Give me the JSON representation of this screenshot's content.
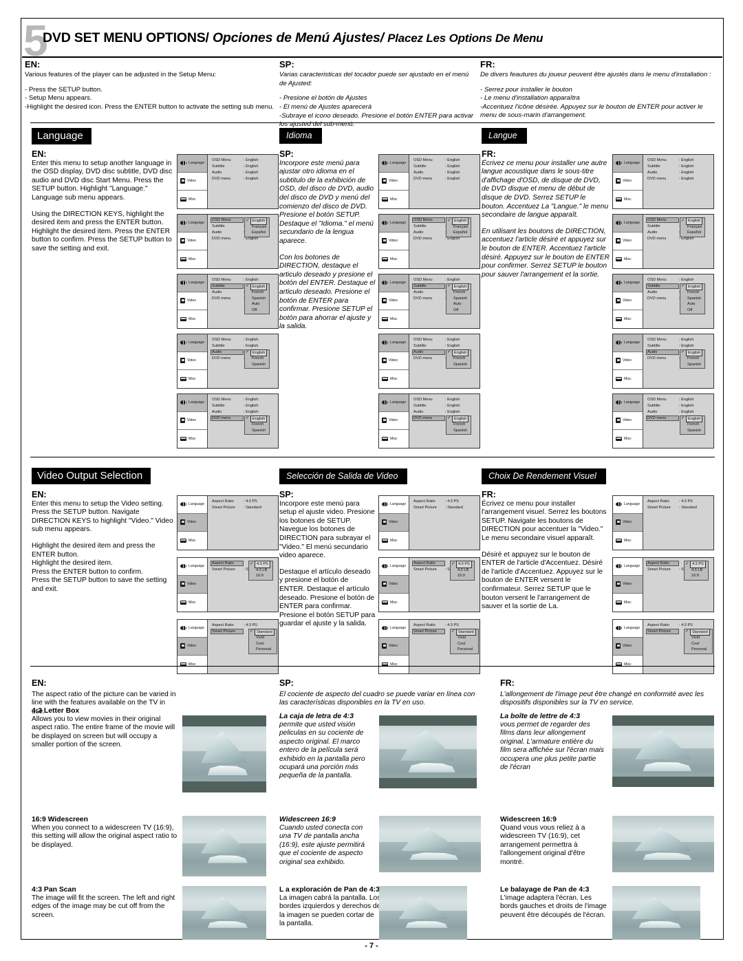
{
  "chapter": {
    "number": "5",
    "title_en": "DVD SET MENU OPTIONS/",
    "title_sp": "Opciones de Menú Ajustes/",
    "title_fr": "Placez Les Options De Menu"
  },
  "header": {
    "en": {
      "tag": "EN:",
      "lead": "Various features of the player can be adjusted in the Setup Menu:",
      "bullets": [
        "- Press the SETUP button.",
        "- Setup Menu appears.",
        "-Highlight the desired icon. Press the ENTER button to activate the setting sub menu."
      ]
    },
    "sp": {
      "tag": "SP:",
      "lead": "Varias caracteristicas del tocador puede ser ajustado en el menú de Ajusted:",
      "bullets": [
        "- Presione el botón de Ajustes",
        "- El menú de Ajustes aparecerá",
        "-Subraye el icono deseado. Presione el botón ENTER para activar los ajusted del sub-menú."
      ]
    },
    "fr": {
      "tag": "FR:",
      "lead": "De divers feautures du joueur peuvent être ajustés dans le menu d'installation :",
      "bullets": [
        "- Serrez pour installer le bouton",
        "- Le menu d'installation apparaîtra",
        "-Accentuez l'icône désirée. Appuyez sur le bouton de ENTER pour activer le menu de sous-marin d'arrangement."
      ]
    }
  },
  "language_section": {
    "banner_en": "Language",
    "banner_sp": "Idioma",
    "banner_fr": "Langue",
    "en": {
      "tag": "EN:",
      "p1": "Enter this menu to setup another language in the OSD display, DVD disc subtitle, DVD disc audio and DVD disc Start Menu. Press the SETUP button. Highlight \"Language.\" Language sub menu appears.",
      "p2": "Using the DIRECTION KEYS, highlight the desired item and press the ENTER button.  Highlight the desired item. Press the ENTER button to confirm. Press the SETUP button to save the setting and exit."
    },
    "sp": {
      "tag": "SP:",
      "p1": "Incorpore este menú para ajustar otro idioma en el subtitulo de la exhibición de OSD, del disco de DVD, audio del disco de DVD y menú del comienzo del disco de DVD. Presione el botón SETUP. Destaque el \"Idioma.\" el menú secundario de la lengua aparece.",
      "p2": "Con los botones de DIRECTION, destaque el articulo deseado y presione el botón del ENTER. Destaque el articulo deseado. Presione el botón de ENTER para confirmar. Presione SETUP el botón para ahorrar el ajuste y la salida."
    },
    "fr": {
      "tag": "FR:",
      "p1": "Écrivez ce menu pour installer une autre langue acoustique dans le sous-titre d'affichage d'OSD, de disque de DVD, de DVD disque et menu de début de disque de DVD. Serrez SETUP le bouton. Accentuez La \"Langue.\" le menu secondaire de langue apparaît.",
      "p2": "En utilisant les boutons de DIRECTION, accentuez l'article désiré et appuyez sur le bouton de ENTER. Accentuez l'article désiré. Appuyez sur le bouton de ENTER pour confirmer. Serrez SETUP le bouton pour sauver l'arrangement et la sortie."
    }
  },
  "video_section": {
    "banner_en": "Video Output Selection",
    "banner_sp": "Selección de Salida de Video",
    "banner_fr": "Choix De Rendement Visuel",
    "en": {
      "tag": "EN:",
      "p1": "Enter this menu to setup the Video setting. Press the SETUP button. Navigate DIRECTION KEYS to highlight \"Video.\" Video sub menu appears.",
      "p2": "Highlight the desired item and press the ENTER button.\nHighlight the desired item.\nPress the ENTER button to confirm.\nPress the SETUP button to save the setting and exit."
    },
    "sp": {
      "tag": "SP:",
      "p1": "Incorpore este menú para setup el ajuste video. Presione los botones de SETUP. Navegue los botones de DIRECTION para subrayar el \"Video.\" El menú secundario video aparece.",
      "p2": "Destaque el artículo deseado y presione el botón de ENTER. Destaque el artículo deseado. Presione el botón de ENTER para confirmar. Presione el botón SETUP para guardar el ajuste y la salida."
    },
    "fr": {
      "tag": "FR:",
      "p1": "Écrivez ce menu pour installer l'arrangement visuel. Serrez les boutons SETUP. Navigate les boutons de DIRECTION pour accentuer la \"Video.\" Le menu secondaire visuel apparaît.",
      "p2": "Désiré et appuyez sur le bouton de ENTER de l'article d'Accentuez. Désiré de l'article d'Accentuez. Appuyez sur le bouton de ENTER versent le confirmateur. Serrez SETUP que le bouton versent le l'arrangement de sauver et la sortie de La."
    }
  },
  "osd": {
    "sidebar": [
      {
        "label": "Language",
        "icon": "globe-icon"
      },
      {
        "label": "Video",
        "icon": "tv-icon"
      },
      {
        "label": "Misc",
        "icon": "misc-icon"
      }
    ],
    "language_rows": [
      {
        "name": "OSD Menu",
        "value": ": English"
      },
      {
        "name": "Subtitle",
        "value": ": English"
      },
      {
        "name": "Audio",
        "value": ": English"
      },
      {
        "name": "DVD menu",
        "value": ": English"
      }
    ],
    "video_rows": [
      {
        "name": "Aspect Ratio",
        "value": ": 4:3 PS"
      },
      {
        "name": "Smart Picture",
        "value": ": Standard"
      }
    ],
    "dropdowns": {
      "osd_menu": [
        "English",
        "Français",
        "Español"
      ],
      "subtitle": [
        "English",
        "French",
        "Spanish",
        "Auto",
        "Off"
      ],
      "audio": [
        "English",
        "French",
        "Spanish"
      ],
      "dvd_menu": [
        "English",
        "French",
        "Spanish"
      ],
      "aspect_ratio": [
        "4:3 PS",
        "4:3 LB",
        "16:9"
      ],
      "smart_picture": [
        "Standard",
        "Vivid",
        "Cool",
        "Personal"
      ]
    },
    "check_glyph": "✓"
  },
  "aspect": {
    "en": {
      "tag": "EN:",
      "intro": "The aspect ratio of the picture can be varied in line with the features available on the TV in use.",
      "items": [
        {
          "head": "4:3 Letter Box",
          "body": "Allows you to view movies in their original aspect ratio. The entire frame of the movie will be displayed on screen but will occupy a smaller portion of the screen."
        },
        {
          "head": "16:9 Widescreen",
          "body": "When you connect to a widescreen TV (16:9), this setting will allow the original aspect ratio to be displayed."
        },
        {
          "head": "4:3 Pan Scan",
          "body": "The image will fit the screen. The left and right edges of the image may be cut off from the screen."
        }
      ]
    },
    "sp": {
      "tag": "SP:",
      "intro": "El cociente de aspecto del cuadro se puede variar en línea con las características disponibles en la TV en uso.",
      "items": [
        {
          "head": "La caja de letra de 4:3",
          "body": "permite que usted visión peliculas en su cociente de aspecto original. El marco entero de la película será exhibido en la pantalla pero ocupará una porción más pequeña de la pantalla."
        },
        {
          "head": "Widescreen 16:9",
          "body": "Cuando usted conecta con una TV de pantalla ancha (16:9), este ajuste permitirá que el cociente de aspecto original sea exhibido."
        },
        {
          "head": "L a exploración de Pan de 4:3",
          "body": "La imagen cabrá la pantalla. Los bordes izquierdos y derechos de la imagen se pueden cortar de la pantalla."
        }
      ]
    },
    "fr": {
      "tag": "FR:",
      "intro": "L'allongement de l'image peut être changé en conformité avec les dispositifs disponibles sur la TV en service.",
      "items": [
        {
          "head": "La boîte de lettre de 4:3",
          "body": "vous permet de regarder des films dans leur allongement original. L'armature entière du film sera affichée sur l'écran mais occupera une plus petite partie de l'écran"
        },
        {
          "head": "Widescreen 16:9",
          "body": "Quand vous vous reliez à a widescreen TV (16:9), cet arrangement permettra à l'allongement original d'être montré."
        },
        {
          "head": "Le balayage de Pan de 4:3",
          "body": "L'image adaptera l'écran. Les bords gauches et droits de l'image peuvent être découpés de l'écran."
        }
      ]
    },
    "photo_alt": "iceberg-photo"
  },
  "footer": {
    "page": "- 7 -"
  }
}
